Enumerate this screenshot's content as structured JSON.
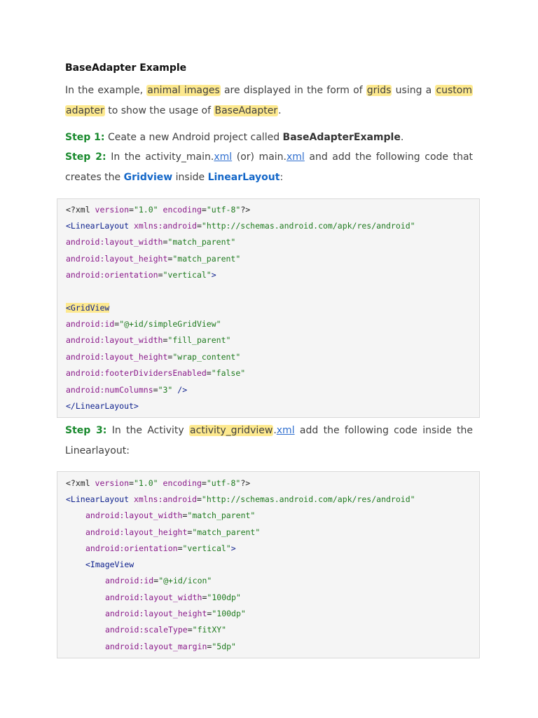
{
  "heading": "BaseAdapter Example",
  "intro": {
    "t1": "In the example,",
    "h1": "animal images",
    "t2": "are displayed in the form of",
    "h2": "grids",
    "t3": "using a",
    "h3a": "custom",
    "h3b": "adapter",
    "t4": "to show the usage of",
    "h4": "BaseAdapter",
    "t5": "."
  },
  "step1": {
    "label": "Step 1:",
    "text": "Ceate a new Android project called",
    "name": "BaseAdapterExample",
    "end": "."
  },
  "step2": {
    "label": "Step 2:",
    "t1": "In the activity_main.",
    "l1": "xml",
    "t2": "(or) main.",
    "l2": "xml",
    "t3": "and add the following code that creates the",
    "b1": "Gridview",
    "t4": "inside",
    "b2": "LinearLayout",
    "t5": ":"
  },
  "code1": {
    "xml_decl_open": "<?xml ",
    "version_attr": "version",
    "version_val": "\"1.0\"",
    "encoding_attr": "encoding",
    "encoding_val": "\"utf-8\"",
    "xml_decl_close": "?>",
    "ll_open": "<LinearLayout",
    "xmlns_attr": "xmlns:android",
    "xmlns_val": "\"http://schemas.android.com/apk/res/android\"",
    "lw_attr": "android:layout_width",
    "lw_val": "\"match_parent\"",
    "lh_attr": "android:layout_height",
    "lh_val": "\"match_parent\"",
    "or_attr": "android:orientation",
    "or_val": "\"vertical\"",
    "gt": ">",
    "gv_open": "<GridView",
    "id_attr": "android:id",
    "id_val": "\"@+id/simpleGridView\"",
    "gw_attr": "android:layout_width",
    "gw_val": "\"fill_parent\"",
    "gh_attr": "android:layout_height",
    "gh_val": "\"wrap_content\"",
    "fd_attr": "android:footerDividersEnabled",
    "fd_val": "\"false\"",
    "nc_attr": "android:numColumns",
    "nc_val": "\"3\"",
    "self_close": " />",
    "ll_close": "</LinearLayout>"
  },
  "step3": {
    "label": "Step 3:",
    "t1": "In the Activity",
    "h1": "activity_gridview",
    "dot": ".",
    "l1": "xml",
    "t2": "add the following code inside the Linearlayout:"
  },
  "code2": {
    "xml_decl_open": "<?xml ",
    "version_attr": "version",
    "version_val": "\"1.0\"",
    "encoding_attr": "encoding",
    "encoding_val": "\"utf-8\"",
    "xml_decl_close": "?>",
    "ll_open": "<LinearLayout",
    "xmlns_attr": "xmlns:android",
    "xmlns_val": "\"http://schemas.android.com/apk/res/android\"",
    "lw_attr": "android:layout_width",
    "lw_val": "\"match_parent\"",
    "lh_attr": "android:layout_height",
    "lh_val": "\"match_parent\"",
    "or_attr": "android:orientation",
    "or_val": "\"vertical\"",
    "gt": ">",
    "iv_open": "<ImageView",
    "id_attr": "android:id",
    "id_val": "\"@+id/icon\"",
    "iw_attr": "android:layout_width",
    "iw_val": "\"100dp\"",
    "ih_attr": "android:layout_height",
    "ih_val": "\"100dp\"",
    "st_attr": "android:scaleType",
    "st_val": "\"fitXY\"",
    "lm_attr": "android:layout_margin",
    "lm_val": "\"5dp\""
  }
}
